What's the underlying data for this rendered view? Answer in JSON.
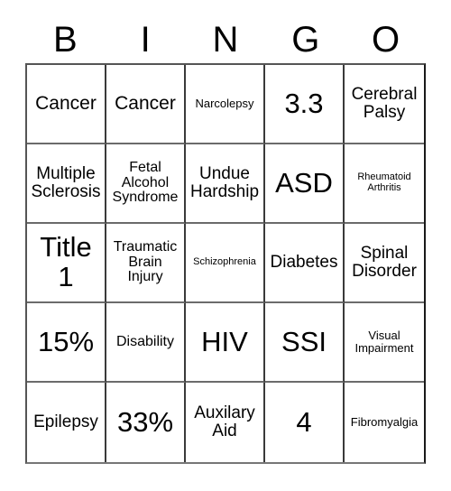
{
  "header": {
    "letters": [
      "B",
      "I",
      "N",
      "G",
      "O"
    ]
  },
  "grid": {
    "columns": 5,
    "rows": 5,
    "cells": [
      {
        "label": "Cancer",
        "size": "l"
      },
      {
        "label": "Cancer",
        "size": "l"
      },
      {
        "label": "Narcolepsy",
        "size": "xs"
      },
      {
        "label": "3.3",
        "size": "xxl"
      },
      {
        "label": "Cerebral Palsy",
        "size": "m"
      },
      {
        "label": "Multiple Sclerosis",
        "size": "m"
      },
      {
        "label": "Fetal Alcohol Syndrome",
        "size": "s"
      },
      {
        "label": "Undue Hardship",
        "size": "m"
      },
      {
        "label": "ASD",
        "size": "xxl"
      },
      {
        "label": "Rheumatoid Arthritis",
        "size": "xxs"
      },
      {
        "label": "Title 1",
        "size": "xxl"
      },
      {
        "label": "Traumatic Brain Injury",
        "size": "s"
      },
      {
        "label": "Schizophrenia",
        "size": "xxs"
      },
      {
        "label": "Diabetes",
        "size": "m"
      },
      {
        "label": "Spinal Disorder",
        "size": "m"
      },
      {
        "label": "15%",
        "size": "xxl"
      },
      {
        "label": "Disability",
        "size": "s"
      },
      {
        "label": "HIV",
        "size": "xxl"
      },
      {
        "label": "SSI",
        "size": "xxl"
      },
      {
        "label": "Visual Impairment",
        "size": "xs"
      },
      {
        "label": "Epilepsy",
        "size": "m"
      },
      {
        "label": "33%",
        "size": "xxl"
      },
      {
        "label": "Auxilary Aid",
        "size": "m"
      },
      {
        "label": "4",
        "size": "xxl"
      },
      {
        "label": "Fibromyalgia",
        "size": "xs"
      }
    ]
  },
  "colors": {
    "background": "#ffffff",
    "text": "#000000",
    "grid_line": "#3a3a3a"
  }
}
